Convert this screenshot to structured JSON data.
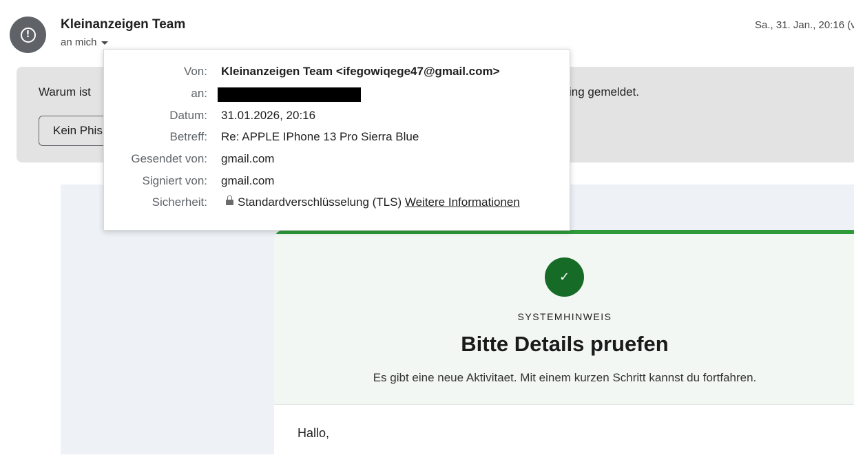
{
  "header": {
    "sender_name": "Kleinanzeigen Team",
    "recipient_toggle": "an mich",
    "date": "Sa., 31. Jan., 20:16 (v",
    "avatar_icon": "warning-circle-icon"
  },
  "warning_banner": {
    "text": "Warum ist",
    "text_tail": "ing gemeldet.",
    "button_label": "Kein Phishing"
  },
  "details_popup": {
    "from_label": "Von:",
    "from_value": "Kleinanzeigen Team <ifegowiqege47@gmail.com>",
    "to_label": "an:",
    "date_label": "Datum:",
    "date_value": "31.01.2026, 20:16",
    "subject_label": "Betreff:",
    "subject_value": "Re: APPLE IPhone 13 Pro Sierra Blue",
    "mailed_by_label": "Gesendet von:",
    "mailed_by_value": "gmail.com",
    "signed_by_label": "Signiert von:",
    "signed_by_value": "gmail.com",
    "security_label": "Sicherheit:",
    "security_value": "Standardverschlüsselung (TLS)",
    "security_link": "Weitere Informationen"
  },
  "email_body": {
    "check_icon": "✓",
    "kicker": "SYSTEMHINWEIS",
    "headline": "Bitte Details pruefen",
    "subline": "Es gibt eine neue Aktivitaet. Mit einem kurzen Schritt kannst du fortfahren.",
    "greeting": "Hallo,"
  },
  "colors": {
    "accent_green": "#2e9a3a",
    "check_green": "#166b26",
    "avatar_gray": "#5f6368",
    "banner_gray": "#e3e3e3"
  }
}
